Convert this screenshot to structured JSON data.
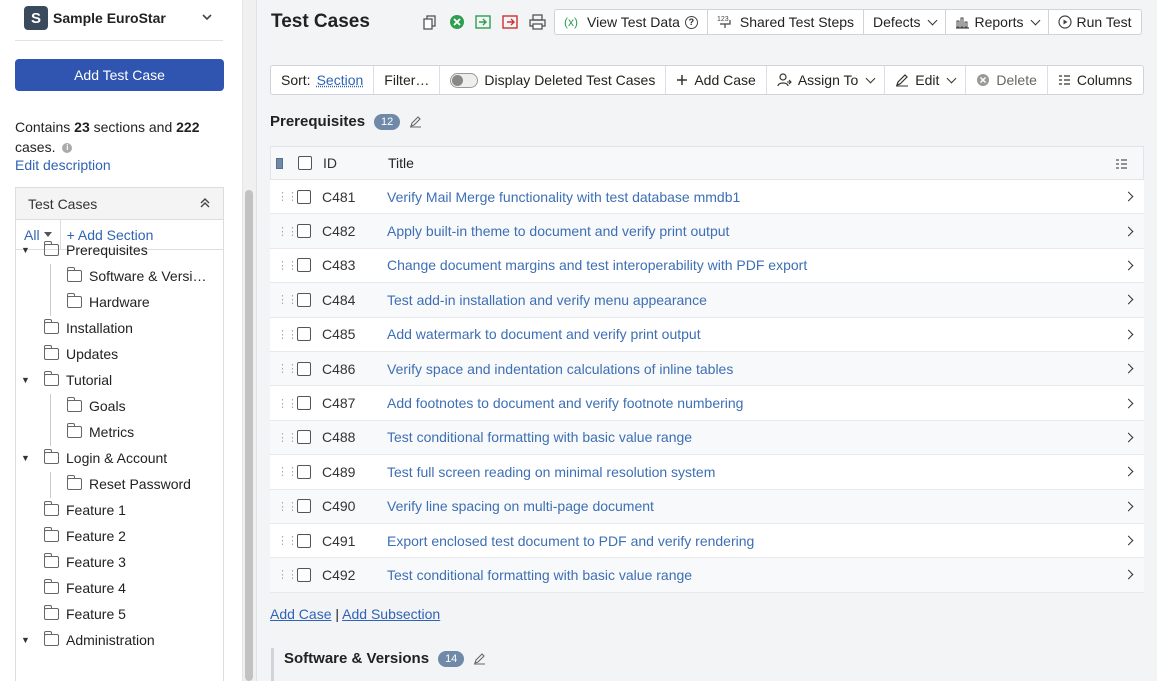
{
  "project": {
    "badge": "S",
    "name": "Sample EuroStar"
  },
  "sidebar": {
    "add_button": "Add Test Case",
    "summary": {
      "prefix": "Contains",
      "sections": "23",
      "middle": "sections and",
      "cases": "222",
      "suffix": "cases."
    },
    "edit_description": "Edit description",
    "tree_title": "Test Cases",
    "filter_all": "All",
    "add_section": "+ Add Section",
    "tree": [
      {
        "label": "Prerequisites",
        "level": 0,
        "expanded": true
      },
      {
        "label": "Software & Versi…",
        "level": 1
      },
      {
        "label": "Hardware",
        "level": 1
      },
      {
        "label": "Installation",
        "level": 0
      },
      {
        "label": "Updates",
        "level": 0
      },
      {
        "label": "Tutorial",
        "level": 0,
        "expanded": true
      },
      {
        "label": "Goals",
        "level": 1
      },
      {
        "label": "Metrics",
        "level": 1
      },
      {
        "label": "Login & Account",
        "level": 0,
        "expanded": true
      },
      {
        "label": "Reset Password",
        "level": 1
      },
      {
        "label": "Feature 1",
        "level": 0
      },
      {
        "label": "Feature 2",
        "level": 0
      },
      {
        "label": "Feature 3",
        "level": 0
      },
      {
        "label": "Feature 4",
        "level": 0
      },
      {
        "label": "Feature 5",
        "level": 0
      },
      {
        "label": "Administration",
        "level": 0,
        "expanded": true
      }
    ]
  },
  "header": {
    "title": "Test Cases",
    "buttons": {
      "view_test_data": "View Test Data",
      "shared_steps": "Shared Test Steps",
      "defects": "Defects",
      "reports": "Reports",
      "run_test": "Run Test"
    }
  },
  "toolbar": {
    "sort_label": "Sort:",
    "sort_value": "Section",
    "filter": "Filter…",
    "display_deleted": "Display Deleted Test Cases",
    "add_case": "Add Case",
    "assign_to": "Assign To",
    "edit": "Edit",
    "delete": "Delete",
    "columns": "Columns"
  },
  "section": {
    "title": "Prerequisites",
    "count": "12",
    "columns": {
      "id": "ID",
      "title": "Title"
    },
    "rows": [
      {
        "id": "C481",
        "title": "Verify Mail Merge functionality with test database mmdb1"
      },
      {
        "id": "C482",
        "title": "Apply built-in theme to document and verify print output"
      },
      {
        "id": "C483",
        "title": "Change document margins and test interoperability with PDF export"
      },
      {
        "id": "C484",
        "title": "Test add-in installation and verify menu appearance"
      },
      {
        "id": "C485",
        "title": "Add watermark to document and verify print output"
      },
      {
        "id": "C486",
        "title": "Verify space and indentation calculations of inline tables"
      },
      {
        "id": "C487",
        "title": "Add footnotes to document and verify footnote numbering"
      },
      {
        "id": "C488",
        "title": "Test conditional formatting with basic value range"
      },
      {
        "id": "C489",
        "title": "Test full screen reading on minimal resolution system"
      },
      {
        "id": "C490",
        "title": "Verify line spacing on multi-page document"
      },
      {
        "id": "C491",
        "title": "Export enclosed test document to PDF and verify rendering"
      },
      {
        "id": "C492",
        "title": "Test conditional formatting with basic value range"
      }
    ],
    "add_case_link": "Add Case",
    "divider": "|",
    "add_subsection_link": "Add Subsection"
  },
  "subsection": {
    "title": "Software & Versions",
    "count": "14"
  },
  "colors": {
    "primary": "#2f55b0",
    "link": "#3d6fb5",
    "badge": "#7089a8"
  }
}
